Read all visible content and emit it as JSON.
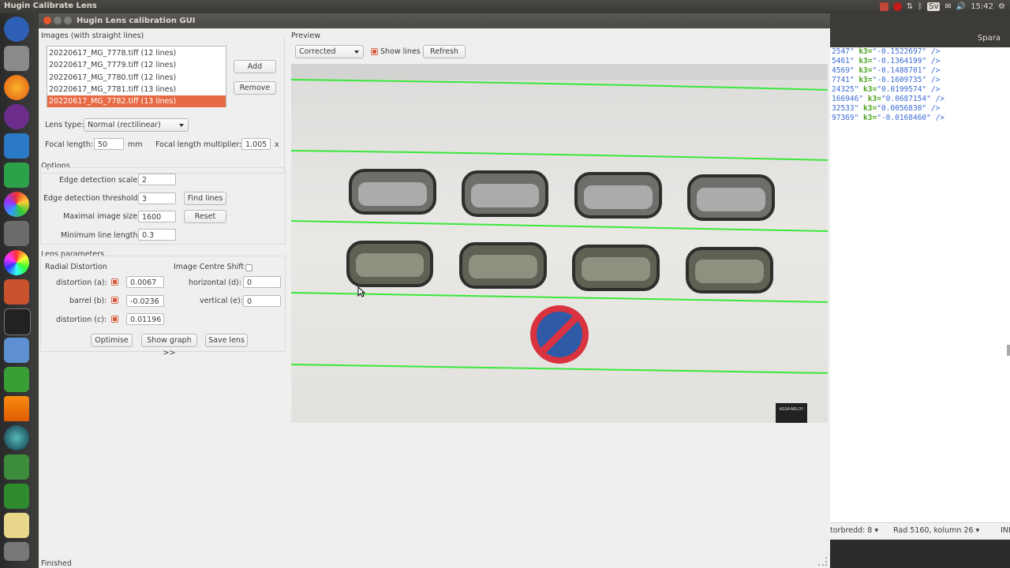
{
  "topbar": {
    "app_title": "Hugin Calibrate Lens",
    "lang": "Sv",
    "time": "15:42"
  },
  "window": {
    "title": "Hugin Lens calibration GUI"
  },
  "images": {
    "section_label": "Images (with straight lines)",
    "files": [
      "20220617_MG_7778.tiff (12 lines)",
      "20220617_MG_7779.tiff (12 lines)",
      "20220617_MG_7780.tiff (12 lines)",
      "20220617_MG_7781.tiff (13 lines)",
      "20220617_MG_7782.tiff (13 lines)"
    ],
    "selected_index": 4,
    "add_label": "Add",
    "remove_label": "Remove"
  },
  "lens": {
    "type_label": "Lens type:",
    "type_value": "Normal (rectilinear)",
    "focal_label": "Focal length:",
    "focal_value": "50",
    "focal_unit": "mm",
    "multiplier_label": "Focal length multiplier:",
    "multiplier_value": "1.005",
    "multiplier_unit": "x"
  },
  "options": {
    "section_label": "Options",
    "edge_scale_label": "Edge detection scale:",
    "edge_scale_value": "2",
    "edge_threshold_label": "Edge detection threshold:",
    "edge_threshold_value": "3",
    "find_lines_label": "Find lines",
    "max_size_label": "Maximal image size:",
    "max_size_value": "1600",
    "reset_label": "Reset",
    "min_line_label": "Minimum line length:",
    "min_line_value": "0.3"
  },
  "params": {
    "section_label": "Lens parameters",
    "radial_label": "Radial Distortion",
    "centre_shift_label": "Image Centre Shift",
    "a_label": "distortion (a):",
    "a_value": "0.0067",
    "b_label": "barrel (b):",
    "b_value": "-0.0236",
    "c_label": "distortion (c):",
    "c_value": "0.01196",
    "d_label": "horizontal (d):",
    "d_value": "0",
    "e_label": "vertical (e):",
    "e_value": "0",
    "optimise_label": "Optimise",
    "show_graph_label": "Show graph >>",
    "save_lens_label": "Save lens"
  },
  "preview": {
    "section_label": "Preview",
    "mode_value": "Corrected",
    "show_lines_label": "Show lines",
    "refresh_label": "Refresh",
    "sign_text": "ASSA ABLOY"
  },
  "status": {
    "text": "Finished"
  },
  "bg_editor": {
    "save_label": "Spara",
    "lines": [
      {
        "pre": "2547\" ",
        "k": "k3=",
        "post": "\"-0.1522697\" />"
      },
      {
        "pre": "5461\" ",
        "k": "k3=",
        "post": "\"-0.1364199\" />"
      },
      {
        "pre": "4569\" ",
        "k": "k3=",
        "post": "\"-0.1488701\" />"
      },
      {
        "pre": "7741\" ",
        "k": "k3=",
        "post": "\"-0.1609735\" />"
      },
      {
        "pre": "24325\" ",
        "k": "k3=",
        "post": "\"0.0199574\" />"
      },
      {
        "pre": "166946\" ",
        "k": "k3=",
        "post": "\"0.0687154\" />"
      },
      {
        "pre": "32533\" ",
        "k": "k3=",
        "post": "\"0.0056830\" />"
      },
      {
        "pre": "97369\" ",
        "k": "k3=",
        "post": "\"-0.0168460\" />"
      }
    ],
    "status_tab": "torbredd: 8",
    "status_pos": "Rad 5160, kolumn 26",
    "status_mode": "INF"
  },
  "colors": {
    "accent": "#e66a43",
    "line_green": "#39e83a"
  }
}
